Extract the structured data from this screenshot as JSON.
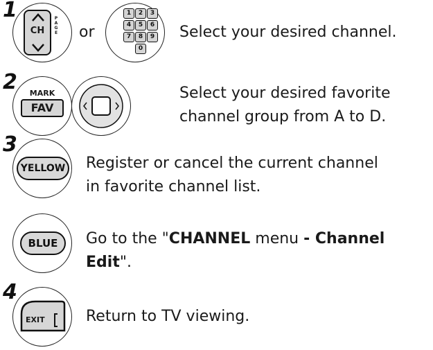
{
  "steps": [
    {
      "num": "1",
      "connector": "or",
      "text": "Select your desired channel."
    },
    {
      "num": "2",
      "line1": "Select your desired favorite",
      "line2": "channel group from A to D."
    },
    {
      "num": "3",
      "line1": "Register or cancel the current channel",
      "line2": "in favorite channel list."
    },
    {
      "line1_pre": "Go to the \"",
      "line1_bold1": "CHANNEL",
      "line1_mid": " menu ",
      "line1_bold2": "- Channel",
      "line2_bold": "Edit",
      "line2_post": "\"."
    },
    {
      "num": "4",
      "text": "Return to TV viewing."
    }
  ],
  "buttons": {
    "ch": {
      "label": "CH",
      "page": "PAGE"
    },
    "keypad": [
      "1",
      "2",
      "3",
      "4",
      "5",
      "6",
      "7",
      "8",
      "9",
      "0"
    ],
    "mark": "MARK",
    "fav": "FAV",
    "yellow": "YELLOW",
    "blue": "BLUE",
    "exit": "EXIT"
  },
  "icons": {
    "ch_up": "chevron-up-icon",
    "ch_down": "chevron-down-icon",
    "nav": "navigation-pad-icon"
  }
}
